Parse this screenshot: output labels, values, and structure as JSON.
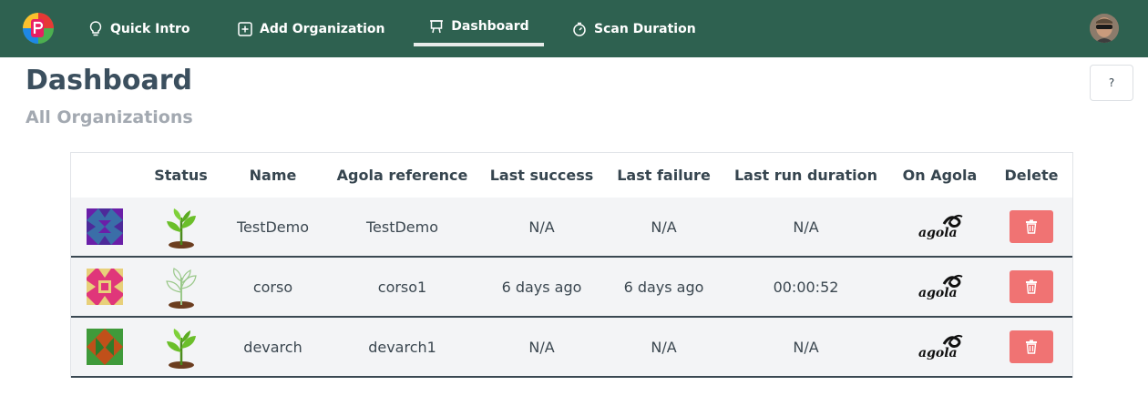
{
  "nav": {
    "items": [
      {
        "label": "Quick Intro",
        "icon": "lightbulb-icon"
      },
      {
        "label": "Add Organization",
        "icon": "plus-square-icon"
      },
      {
        "label": "Dashboard",
        "icon": "presentation-icon",
        "active": true
      },
      {
        "label": "Scan Duration",
        "icon": "stopwatch-icon"
      }
    ],
    "colors": {
      "bar": "#2e6150",
      "text": "#ffffff"
    }
  },
  "header": {
    "title": "Dashboard",
    "subtitle": "All Organizations",
    "help_label": "?"
  },
  "table": {
    "columns": [
      "",
      "Status",
      "Name",
      "Agola reference",
      "Last success",
      "Last failure",
      "Last run duration",
      "On Agola",
      "Delete"
    ],
    "rows": [
      {
        "name": "TestDemo",
        "agola_ref": "TestDemo",
        "last_success": "N/A",
        "last_failure": "N/A",
        "duration": "N/A",
        "status_icon": "plant-green-icon",
        "agola_logo_text": "agola"
      },
      {
        "name": "corso",
        "agola_ref": "corso1",
        "last_success": "6 days ago",
        "last_failure": "6 days ago",
        "duration": "00:00:52",
        "status_icon": "plant-outline-icon",
        "agola_logo_text": "agola"
      },
      {
        "name": "devarch",
        "agola_ref": "devarch1",
        "last_success": "N/A",
        "last_failure": "N/A",
        "duration": "N/A",
        "status_icon": "plant-green-icon",
        "agola_logo_text": "agola"
      }
    ],
    "colors": {
      "delete": "#f07373",
      "row_bg": "#f3f4f6"
    }
  }
}
